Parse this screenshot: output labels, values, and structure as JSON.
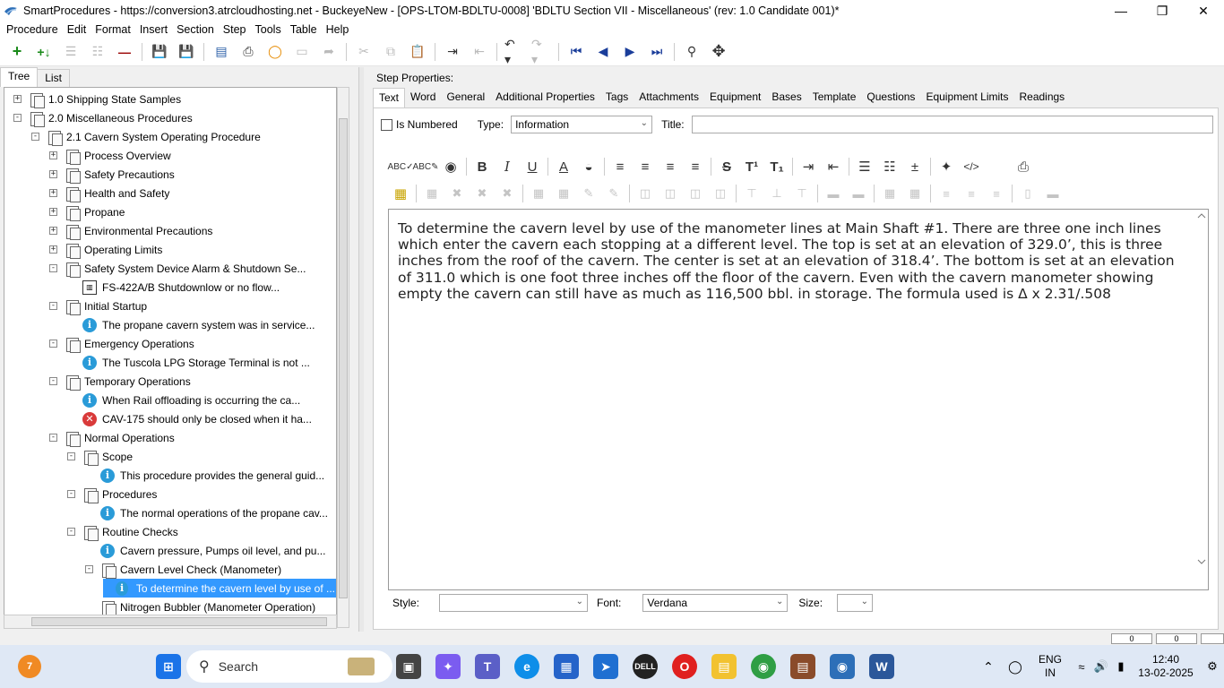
{
  "window": {
    "title": "SmartProcedures - https://conversion3.atrcloudhosting.net - BuckeyeNew - [OPS-LTOM-BDLTU-0008] 'BDLTU Section VII - Miscellaneous' (rev: 1.0 Candidate 001)*"
  },
  "menu": [
    "Procedure",
    "Edit",
    "Format",
    "Insert",
    "Section",
    "Step",
    "Tools",
    "Table",
    "Help"
  ],
  "left_tabs": [
    "Tree",
    "List"
  ],
  "tree": [
    {
      "label": "1.0 Shipping State Samples",
      "indent": 0,
      "exp": "+",
      "icon": "folder"
    },
    {
      "label": "2.0 Miscellaneous Procedures",
      "indent": 0,
      "exp": "-",
      "icon": "folder"
    },
    {
      "label": "2.1 Cavern System Operating Procedure",
      "indent": 1,
      "exp": "-",
      "icon": "folder"
    },
    {
      "label": "Process Overview",
      "indent": 2,
      "exp": "+",
      "icon": "folder"
    },
    {
      "label": "Safety Precautions",
      "indent": 2,
      "exp": "+",
      "icon": "folder"
    },
    {
      "label": "Health and Safety",
      "indent": 2,
      "exp": "+",
      "icon": "folder"
    },
    {
      "label": "Propane",
      "indent": 2,
      "exp": "+",
      "icon": "folder"
    },
    {
      "label": "Environmental Precautions",
      "indent": 2,
      "exp": "+",
      "icon": "folder"
    },
    {
      "label": "Operating Limits",
      "indent": 2,
      "exp": "+",
      "icon": "folder"
    },
    {
      "label": "Safety System Device Alarm & Shutdown Se...",
      "indent": 2,
      "exp": "-",
      "icon": "folder"
    },
    {
      "label": "FS-422A/B Shutdownlow or no flow...",
      "indent": 3,
      "exp": "",
      "icon": "chart"
    },
    {
      "label": "Initial Startup",
      "indent": 2,
      "exp": "-",
      "icon": "folder"
    },
    {
      "label": "The propane cavern system was in service...",
      "indent": 3,
      "exp": "",
      "icon": "info"
    },
    {
      "label": "Emergency Operations",
      "indent": 2,
      "exp": "-",
      "icon": "folder"
    },
    {
      "label": "The Tuscola LPG Storage Terminal is not ...",
      "indent": 3,
      "exp": "",
      "icon": "info"
    },
    {
      "label": "Temporary Operations",
      "indent": 2,
      "exp": "-",
      "icon": "folder"
    },
    {
      "label": "When Rail offloading is occurring the ca...",
      "indent": 3,
      "exp": "",
      "icon": "info"
    },
    {
      "label": "CAV-175 should only be closed when it ha...",
      "indent": 3,
      "exp": "",
      "icon": "error"
    },
    {
      "label": "Normal Operations",
      "indent": 2,
      "exp": "-",
      "icon": "folder"
    },
    {
      "label": "Scope",
      "indent": 3,
      "exp": "-",
      "icon": "folder"
    },
    {
      "label": "This procedure provides the general guid...",
      "indent": 4,
      "exp": "",
      "icon": "info"
    },
    {
      "label": "Procedures",
      "indent": 3,
      "exp": "-",
      "icon": "folder"
    },
    {
      "label": "The normal operations of the propane cav...",
      "indent": 4,
      "exp": "",
      "icon": "info"
    },
    {
      "label": "Routine Checks",
      "indent": 3,
      "exp": "-",
      "icon": "folder"
    },
    {
      "label": "Cavern pressure, Pumps oil level, and pu...",
      "indent": 4,
      "exp": "",
      "icon": "info"
    },
    {
      "label": "Cavern Level Check (Manometer)",
      "indent": 4,
      "exp": "-",
      "icon": "folder"
    },
    {
      "label": "To determine the cavern level by use of ...",
      "indent": 5,
      "exp": "",
      "icon": "info",
      "selected": true
    },
    {
      "label": "Nitrogen Bubbler (Manometer Operation)",
      "indent": 4,
      "exp": "",
      "icon": "folder"
    }
  ],
  "step_properties": {
    "label": "Step Properties:",
    "tabs": [
      "Text",
      "Word",
      "General",
      "Additional Properties",
      "Tags",
      "Attachments",
      "Equipment",
      "Bases",
      "Template",
      "Questions",
      "Equipment Limits",
      "Readings"
    ],
    "is_numbered_label": "Is Numbered",
    "type_label": "Type:",
    "type_value": "Information",
    "title_label": "Title:",
    "title_value": ""
  },
  "editor": {
    "text": "To determine the cavern level by use of the manometer lines at Main Shaft #1. There are three one inch lines which enter the cavern each stopping at a different level. The top is set at an elevation of 329.0’, this is three inches from the roof of the cavern. The center is set at an elevation of 318.4’. The bottom is set at an elevation of 311.0 which is one foot three inches off the floor of the cavern. Even with the cavern manometer showing empty the cavern can still have as much as 116,500 bbl. in storage. The formula used is Δ x 2.31/.508"
  },
  "bottom": {
    "style_label": "Style:",
    "style_value": "",
    "font_label": "Font:",
    "font_value": "Verdana",
    "size_label": "Size:",
    "size_value": ""
  },
  "status": {
    "box1": "0",
    "box2": "0"
  },
  "taskbar": {
    "search_placeholder": "Search",
    "notif_count": "7",
    "lang": "ENG",
    "region": "IN",
    "time": "12:40",
    "date": "13-02-2025"
  }
}
